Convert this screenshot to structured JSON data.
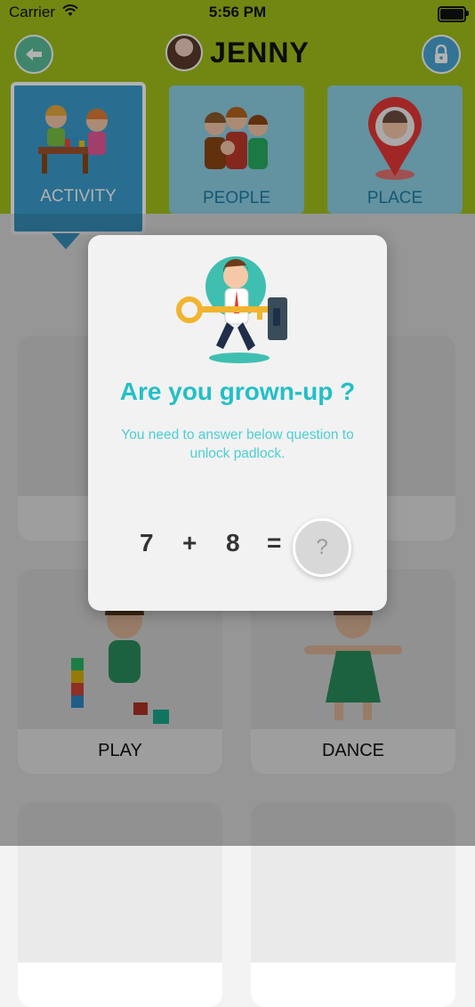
{
  "status": {
    "carrier": "Carrier",
    "time": "5:56 PM"
  },
  "header": {
    "title": "JENNY"
  },
  "categories": [
    {
      "label": "ACTIVITY"
    },
    {
      "label": "PEOPLE"
    },
    {
      "label": "PLACE"
    }
  ],
  "grid": [
    {
      "label": ""
    },
    {
      "label": ""
    },
    {
      "label": "PLAY"
    },
    {
      "label": "DANCE"
    }
  ],
  "modal": {
    "title": "Are you grown-up ?",
    "subtitle": "You need to answer below question to unlock padlock.",
    "equation": {
      "a": "7",
      "op": "+",
      "b": "8",
      "eq": "=",
      "answer_placeholder": "?"
    }
  },
  "colors": {
    "header": "#a3c21b",
    "active_tab": "#3b9ecf",
    "title_accent": "#22c0c6"
  },
  "icons": {
    "back": "arrow-left-icon",
    "lock": "lock-icon",
    "wifi": "wifi-icon",
    "battery": "battery-icon"
  }
}
